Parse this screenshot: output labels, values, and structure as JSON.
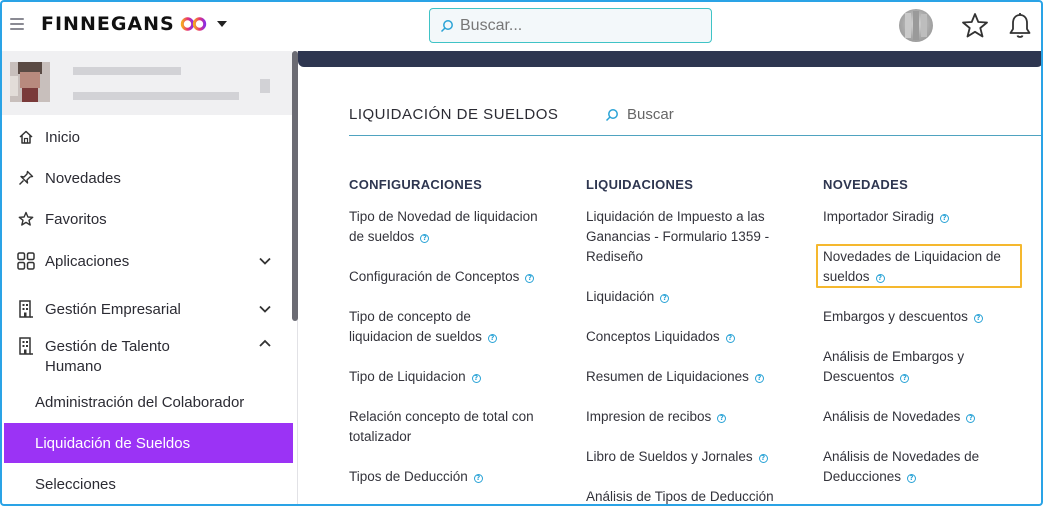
{
  "header": {
    "brand": "FINNEGANS",
    "search_placeholder": "Buscar..."
  },
  "sidebar": {
    "items": [
      {
        "label": "Inicio",
        "icon": "home-icon"
      },
      {
        "label": "Novedades",
        "icon": "pin-icon"
      },
      {
        "label": "Favoritos",
        "icon": "star-icon"
      },
      {
        "label": "Aplicaciones",
        "icon": "grid-icon"
      },
      {
        "label": "Gestión Empresarial",
        "icon": "building-icon"
      },
      {
        "label": "Gestión de Talento",
        "label2": "Humano",
        "icon": "building-icon"
      }
    ],
    "subitems": [
      {
        "label": "Administración del Colaborador"
      },
      {
        "label": "Liquidación de Sueldos"
      },
      {
        "label": "Selecciones"
      }
    ]
  },
  "main": {
    "section_title": "LIQUIDACIÓN DE SUELDOS",
    "search_label": "Buscar",
    "columns": [
      {
        "heading": "CONFIGURACIONES",
        "links": [
          [
            "Tipo de Novedad de liquidacion",
            "de sueldos"
          ],
          [
            "Configuración de Conceptos"
          ],
          [
            "Tipo de concepto de",
            "liquidacion de sueldos"
          ],
          [
            "Tipo de Liquidacion"
          ],
          [
            "Relación concepto de total con",
            "totalizador"
          ],
          [
            "Tipos de Deducción"
          ]
        ]
      },
      {
        "heading": "LIQUIDACIONES",
        "links": [
          [
            "Liquidación de Impuesto a las",
            "Ganancias - Formulario 1359 -",
            "Rediseño"
          ],
          [
            "Liquidación"
          ],
          [
            "Conceptos Liquidados"
          ],
          [
            "Resumen de Liquidaciones"
          ],
          [
            "Impresion de recibos"
          ],
          [
            "Libro de Sueldos y Jornales"
          ],
          [
            "Análisis de Tipos de Deducción"
          ]
        ]
      },
      {
        "heading": "NOVEDADES",
        "links": [
          [
            "Importador Siradig"
          ],
          [
            "Novedades de Liquidacion de",
            "sueldos"
          ],
          [
            "Embargos y descuentos"
          ],
          [
            "Análisis de Embargos y",
            "Descuentos"
          ],
          [
            "Análisis de Novedades"
          ],
          [
            "Análisis de Novedades de",
            "Deducciones"
          ]
        ]
      }
    ]
  },
  "colors": {
    "accent_active": "#9b33f5",
    "highlight": "#f5b82e",
    "search_border": "#3fc3c6",
    "band": "#2e3650"
  }
}
